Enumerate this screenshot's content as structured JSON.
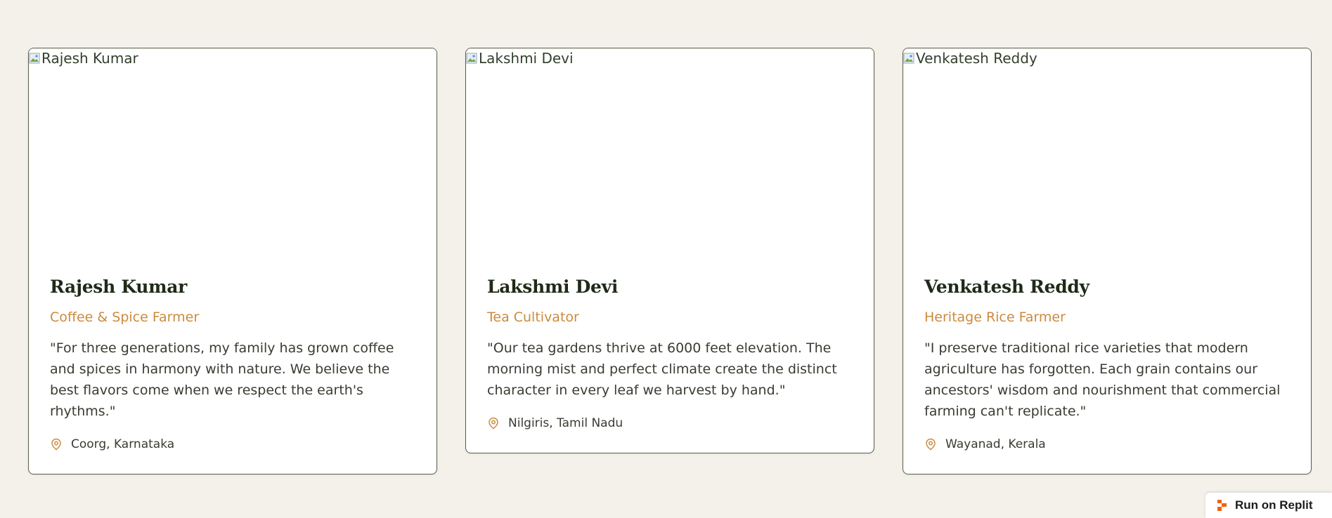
{
  "cards": [
    {
      "image_alt": "Rajesh Kumar",
      "name": "Rajesh Kumar",
      "role": "Coffee & Spice Farmer",
      "quote": "\"For three generations, my family has grown coffee and spices in harmony with nature. We believe the best flavors come when we respect the earth's rhythms.\"",
      "location": "Coorg, Karnataka"
    },
    {
      "image_alt": "Lakshmi Devi",
      "name": "Lakshmi Devi",
      "role": "Tea Cultivator",
      "quote": "\"Our tea gardens thrive at 6000 feet elevation. The morning mist and perfect climate create the distinct character in every leaf we harvest by hand.\"",
      "location": "Nilgiris, Tamil Nadu"
    },
    {
      "image_alt": "Venkatesh Reddy",
      "name": "Venkatesh Reddy",
      "role": "Heritage Rice Farmer",
      "quote": "\"I preserve traditional rice varieties that modern agriculture has forgotten. Each grain contains our ancestors' wisdom and nourishment that commercial farming can't replicate.\"",
      "location": "Wayanad, Kerala"
    }
  ],
  "replit_badge": {
    "label": "Run on Replit",
    "icon": "replit-logo-icon"
  },
  "colors": {
    "background": "#f4f1ea",
    "accent": "#cc8a3c",
    "heading": "#1f2a18",
    "border": "#5a6048",
    "replit_orange": "#f26207"
  }
}
